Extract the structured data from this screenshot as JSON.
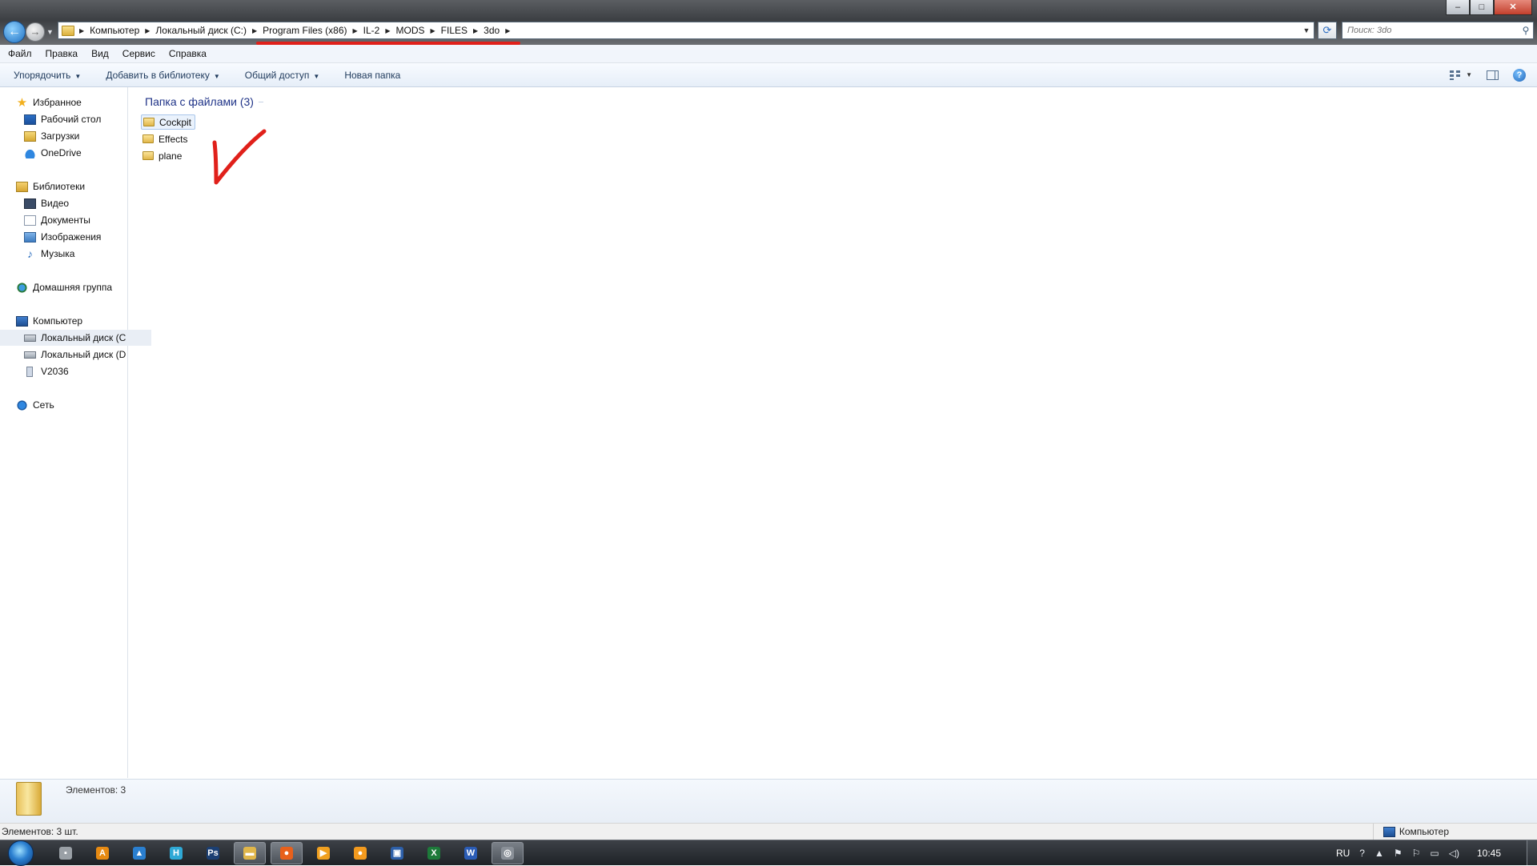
{
  "window": {
    "controls": {
      "minimize": "–",
      "maximize": "□",
      "close": "✕"
    }
  },
  "nav": {
    "back": "←",
    "forward": "→",
    "recent": "▼"
  },
  "address": {
    "crumbs": [
      "Компьютер",
      "Локальный диск (C:)",
      "Program Files (x86)",
      "IL-2",
      "MODS",
      "FILES",
      "3do"
    ],
    "dropdown": "▼",
    "refresh": "⟳"
  },
  "search": {
    "placeholder": "Поиск: 3do",
    "icon": "search-icon"
  },
  "menu": [
    "Файл",
    "Правка",
    "Вид",
    "Сервис",
    "Справка"
  ],
  "commands": {
    "organize": "Упорядочить",
    "add_to_library": "Добавить в библиотеку",
    "share": "Общий доступ",
    "new_folder": "Новая папка",
    "arrow": "▼"
  },
  "sidebar": {
    "favorites": {
      "label": "Избранное",
      "items": [
        "Рабочий стол",
        "Загрузки",
        "OneDrive"
      ]
    },
    "libraries": {
      "label": "Библиотеки",
      "items": [
        "Видео",
        "Документы",
        "Изображения",
        "Музыка"
      ]
    },
    "homegroup": {
      "label": "Домашняя группа"
    },
    "computer": {
      "label": "Компьютер",
      "items": [
        "Локальный диск (C",
        "Локальный диск (D",
        "V2036"
      ]
    },
    "network": {
      "label": "Сеть"
    }
  },
  "content": {
    "group_header": "Папка с файлами (3)",
    "items": [
      "Cockpit",
      "Effects",
      "plane"
    ]
  },
  "details": {
    "text": "Элементов: 3"
  },
  "status": {
    "left": "Элементов: 3 шт.",
    "right": "Компьютер"
  },
  "taskbar": {
    "apps": [
      {
        "name": "app-generic",
        "glyph": "▪",
        "color": "#9aa0a6"
      },
      {
        "name": "app-avast",
        "glyph": "A",
        "color": "#e78a12"
      },
      {
        "name": "app-blue",
        "glyph": "▲",
        "color": "#2a7fd0"
      },
      {
        "name": "app-h",
        "glyph": "H",
        "color": "#2fa9d6"
      },
      {
        "name": "app-photoshop",
        "glyph": "Ps",
        "color": "#1b3f73"
      },
      {
        "name": "app-explorer",
        "glyph": "▬",
        "color": "#e0b64a"
      },
      {
        "name": "app-firefox",
        "glyph": "●",
        "color": "#e8601b"
      },
      {
        "name": "app-player",
        "glyph": "▶",
        "color": "#f0a020"
      },
      {
        "name": "app-orange",
        "glyph": "●",
        "color": "#f39a1e"
      },
      {
        "name": "app-save",
        "glyph": "▣",
        "color": "#2d5fa8"
      },
      {
        "name": "app-excel",
        "glyph": "X",
        "color": "#1d7a3a"
      },
      {
        "name": "app-word",
        "glyph": "W",
        "color": "#2b5cb5"
      },
      {
        "name": "app-misc",
        "glyph": "◎",
        "color": "#8a9098"
      }
    ],
    "tray": {
      "lang": "RU",
      "time": "10:45"
    }
  },
  "colors": {
    "annotation_red": "#e0201a",
    "header_blue": "#1e3287"
  }
}
